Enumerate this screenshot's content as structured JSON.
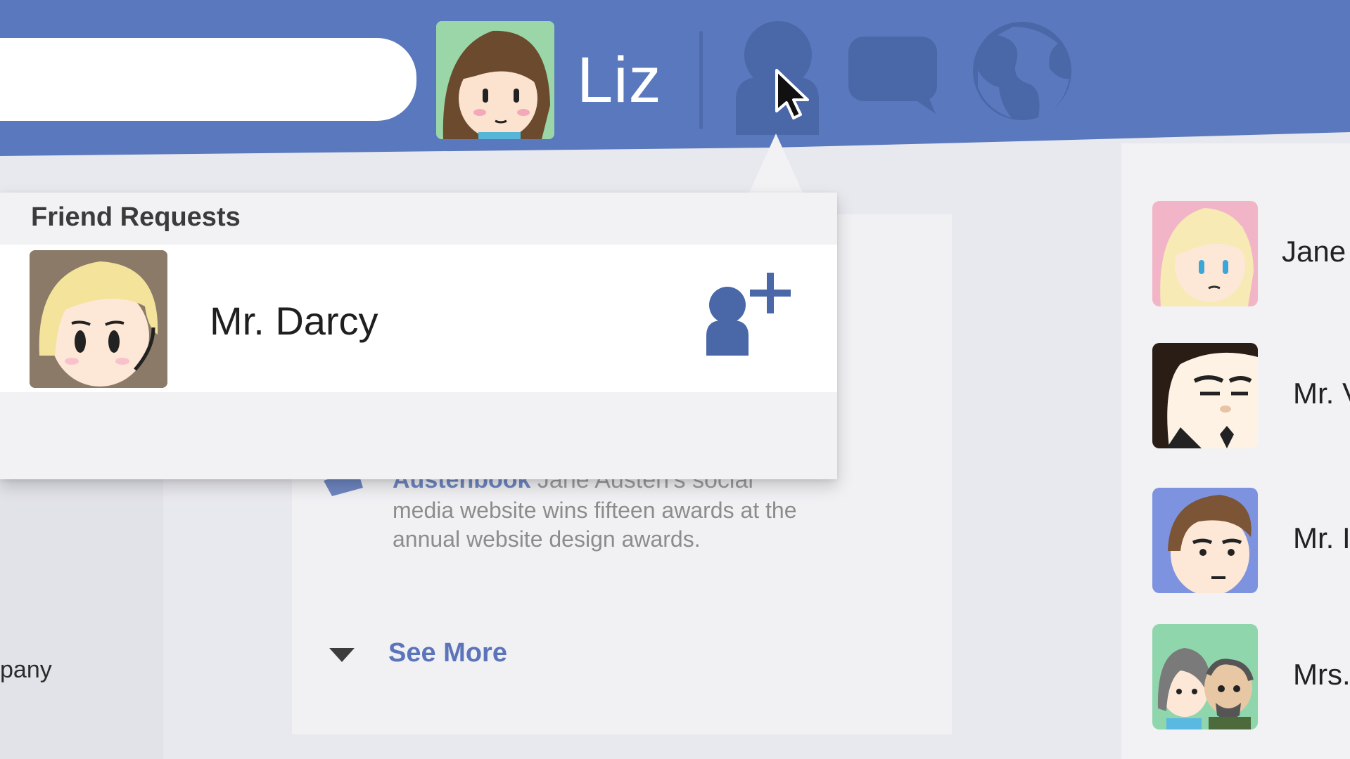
{
  "header": {
    "search": {
      "placeholder": "",
      "value": ""
    },
    "user": {
      "name": "Liz"
    },
    "nav": [
      {
        "name": "friend-requests",
        "icon": "friends-icon"
      },
      {
        "name": "messages",
        "icon": "chat-icon"
      },
      {
        "name": "notifications",
        "icon": "globe-icon"
      }
    ]
  },
  "friend_requests": {
    "title": "Friend Requests",
    "items": [
      {
        "name": "Mr. Darcy",
        "action_icon": "add-friend-icon"
      }
    ]
  },
  "feed": {
    "news": {
      "title": "Austenbook",
      "title_tail": "Jane Austen's social",
      "body": "media website wins fifteen awards at the annual website design awards."
    },
    "see_more": "See More"
  },
  "left_column": {
    "partial_text": "pany"
  },
  "contacts": [
    {
      "name": "Jane"
    },
    {
      "name": "Mr. V"
    },
    {
      "name": "Mr. I"
    },
    {
      "name": "Mrs."
    }
  ],
  "colors": {
    "topbar": "#5a78bd",
    "accent": "#5b74ba",
    "icon_dark": "#4a67a8"
  }
}
